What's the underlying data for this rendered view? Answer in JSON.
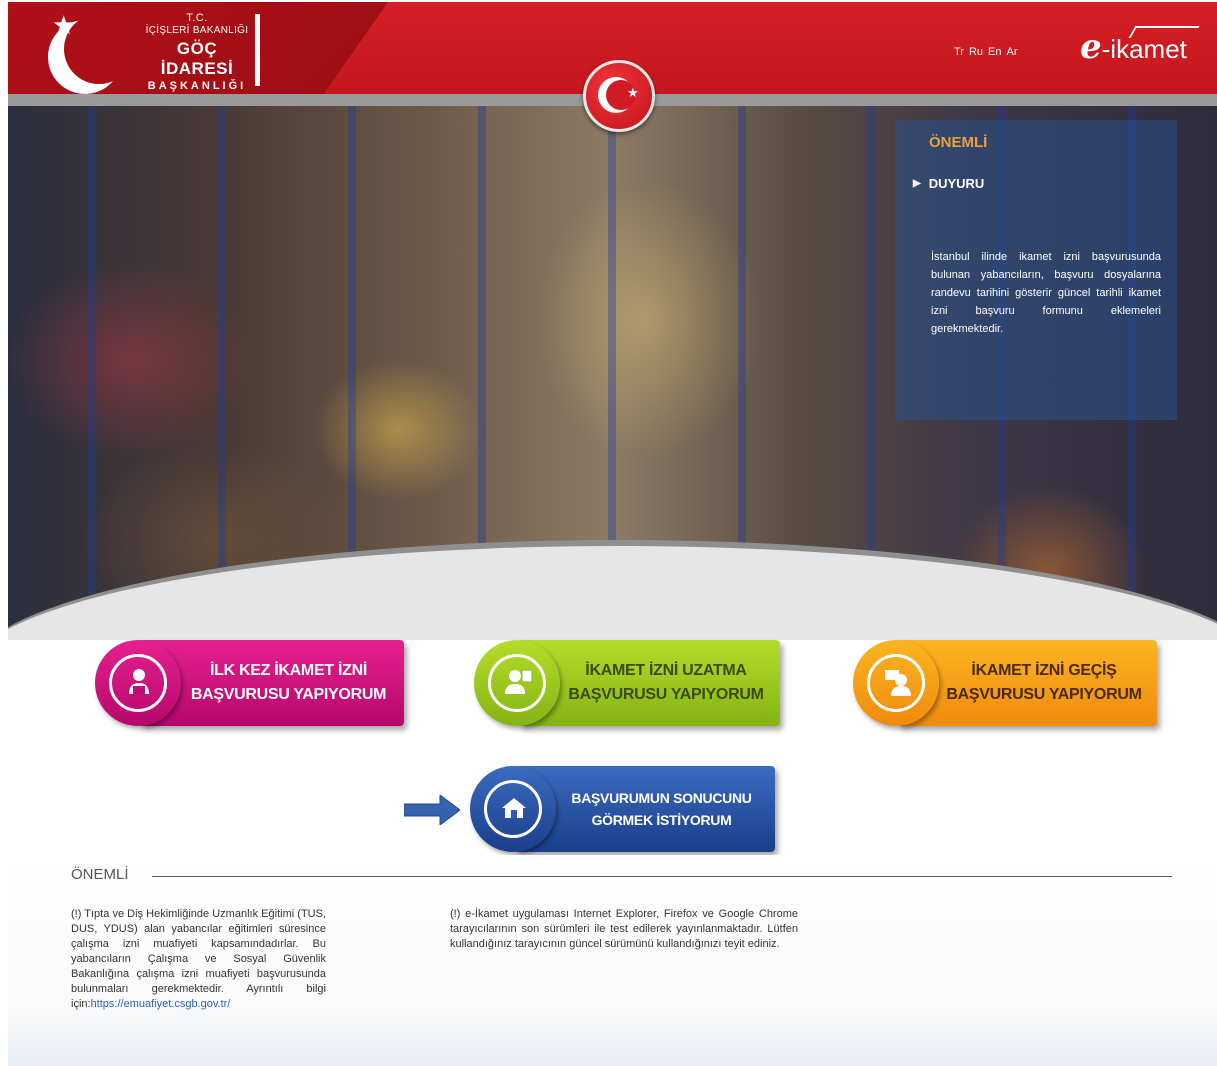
{
  "header": {
    "logo": {
      "line1": "T.C.",
      "line2": "İÇİŞLERİ BAKANLIĞI",
      "line3": "GÖÇ İDARESİ",
      "line4": "BAŞKANLIĞI"
    },
    "languages": [
      "Tr",
      "Ru",
      "En",
      "Ar"
    ],
    "brand_prefix": "e",
    "brand_suffix": "-ikamet"
  },
  "notice_panel": {
    "title": "ÖNEMLİ",
    "item_label": "DUYURU",
    "text": "İstanbul ilinde ikamet izni başvurusunda bulunan yabancıların, başvuru dosyalarına randevu tarihini gösterir güncel tarihli ikamet izni başvuru formunu eklemeleri gerekmektedir."
  },
  "actions": {
    "first_application": {
      "line1": "İLK KEZ İKAMET İZNİ",
      "line2": "BAŞVURUSU YAPIYORUM"
    },
    "extension": {
      "line1": "İKAMET İZNİ UZATMA",
      "line2": "BAŞVURUSU YAPIYORUM"
    },
    "transfer": {
      "line1": "İKAMET İZNİ GEÇİŞ",
      "line2": "BAŞVURUSU YAPIYORUM"
    },
    "result": {
      "line1": "BAŞVURUMUN SONUCUNU",
      "line2": "GÖRMEK İSTİYORUM"
    }
  },
  "bottom": {
    "title": "ÖNEMLİ",
    "note1_text": "(!) Tıpta ve Diş Hekimliğinde Uzmanlık Eğitimi (TUS, DUS, YDUS) alan yabancılar eğitimleri süresince çalışma izni muafiyeti kapsamındadırlar. Bu yabancıların Çalışma ve Sosyal Güvenlik Bakanlığına çalışma izni muafiyeti başvurusunda bulunmaları gerekmektedir. Ayrıntılı bilgi için:",
    "note1_link": "https://emuafiyet.csgb.gov.tr/",
    "note2_text": "(!) e-İkamet uygulaması Internet Explorer, Firefox ve Google Chrome tarayıcılarının son sürümleri ile test edilerek yayınlanmaktadır. Lütfen kullandığınız tarayıcının güncel sürümünü kullandığınızı teyit ediniz."
  },
  "colors": {
    "header_red": "#c4161d",
    "pink": "#e6208f",
    "green": "#b4dd2b",
    "orange": "#fbb621",
    "blue": "#2a5bb0",
    "notice_accent": "#e8a23a"
  }
}
